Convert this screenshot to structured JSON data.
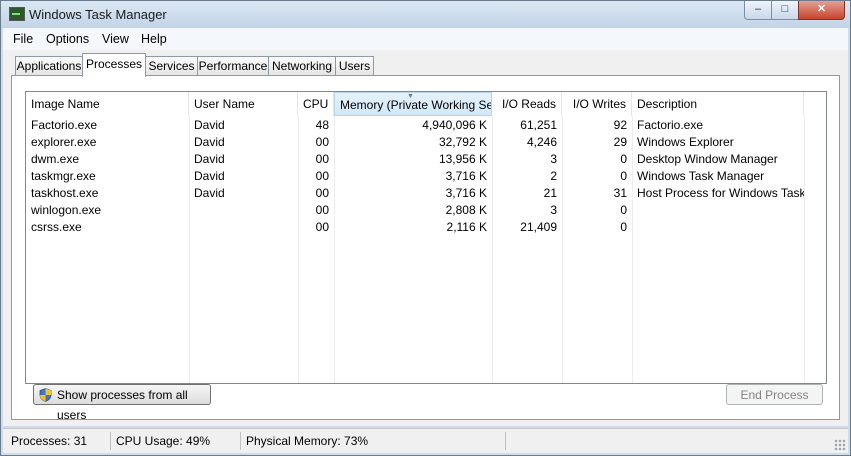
{
  "window": {
    "title": "Windows Task Manager",
    "min_label": "–",
    "max_label": "□",
    "close_label": "✕"
  },
  "menu": [
    "File",
    "Options",
    "View",
    "Help"
  ],
  "tabs": [
    "Applications",
    "Processes",
    "Services",
    "Performance",
    "Networking",
    "Users"
  ],
  "active_tab": "Processes",
  "columns": [
    "Image Name",
    "User Name",
    "CPU",
    "Memory (Private Working Set)",
    "I/O Reads",
    "I/O Writes",
    "Description"
  ],
  "sorted_column": "Memory (Private Working Set)",
  "sort_indicator": "▼",
  "rows": [
    [
      "Factorio.exe",
      "David",
      "48",
      "4,940,096 K",
      "61,251",
      "92",
      "Factorio.exe"
    ],
    [
      "explorer.exe",
      "David",
      "00",
      "32,792 K",
      "4,246",
      "29",
      "Windows Explorer"
    ],
    [
      "dwm.exe",
      "David",
      "00",
      "13,956 K",
      "3",
      "0",
      "Desktop Window Manager"
    ],
    [
      "taskmgr.exe",
      "David",
      "00",
      "3,716 K",
      "2",
      "0",
      "Windows Task Manager"
    ],
    [
      "taskhost.exe",
      "David",
      "00",
      "3,716 K",
      "21",
      "31",
      "Host Process for Windows Tasks"
    ],
    [
      "winlogon.exe",
      "",
      "00",
      "2,808 K",
      "3",
      "0",
      ""
    ],
    [
      "csrss.exe",
      "",
      "00",
      "2,116 K",
      "21,409",
      "0",
      ""
    ]
  ],
  "buttons": {
    "show_all": "Show processes from all users",
    "end_process": "End Process"
  },
  "status": {
    "processes": "Processes: 31",
    "cpu": "CPU Usage: 49%",
    "memory": "Physical Memory: 73%"
  },
  "icons": {
    "app": "task-manager-icon",
    "shield": "uac-shield-icon"
  },
  "colors": {
    "title_bar": "#cfdcea",
    "close_button": "#c7442b",
    "sorted_header": "#d1e8f8"
  }
}
